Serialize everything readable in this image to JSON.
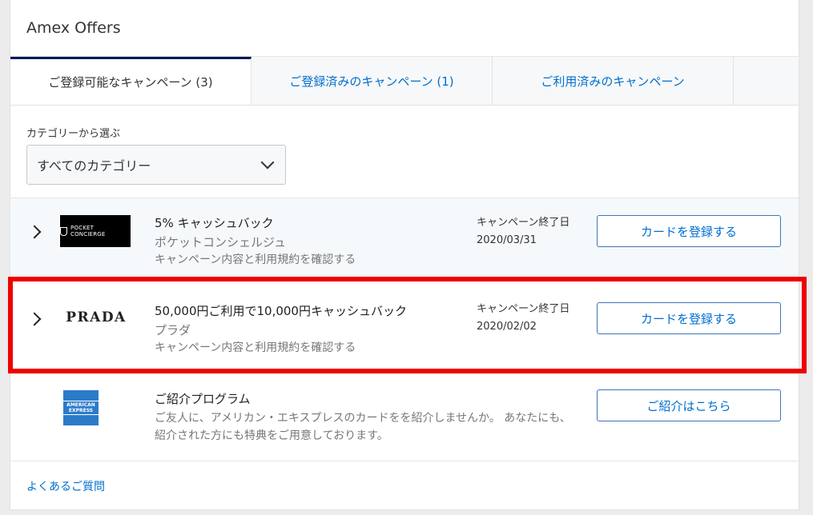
{
  "header": {
    "title": "Amex Offers"
  },
  "tabs": [
    {
      "label": "ご登録可能なキャンペーン (3)"
    },
    {
      "label": "ご登録済みのキャンペーン (1)"
    },
    {
      "label": "ご利用済みのキャンペーン"
    }
  ],
  "filter": {
    "label": "カテゴリーから選ぶ",
    "selected": "すべてのカテゴリー"
  },
  "offers": [
    {
      "logo_text": "POCKET CONCIERGE",
      "title": "5% キャッシュバック",
      "merchant": "ポケットコンシェルジュ",
      "terms_link": "キャンペーン内容と利用規約を確認する",
      "end_label": "キャンペーン終了日",
      "end_date": "2020/03/31",
      "button": "カードを登録する"
    },
    {
      "logo_text": "PRADA",
      "title": "50,000円ご利用で10,000円キャッシュバック",
      "merchant": "プラダ",
      "terms_link": "キャンペーン内容と利用規約を確認する",
      "end_label": "キャンペーン終了日",
      "end_date": "2020/02/02",
      "button": "カードを登録する"
    }
  ],
  "referral": {
    "logo_text": "AMERICAN EXPRESS",
    "title": "ご紹介プログラム",
    "description": "ご友人に、アメリカン・エキスプレスのカードをを紹介しませんか。 あなたにも、紹介された方にも特典をご用意しております。",
    "button": "ご紹介はこちら"
  },
  "faq_link": "よくあるご質問",
  "colors": {
    "accent": "#006fcf",
    "highlight": "#ee0000",
    "active_tab_bar": "#00175a"
  }
}
